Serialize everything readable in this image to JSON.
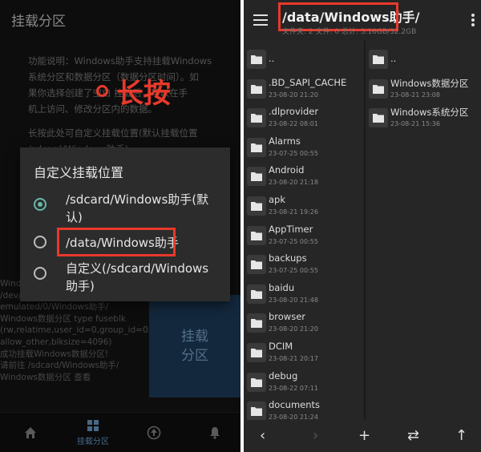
{
  "left": {
    "app_title": "挂载分区",
    "description_lines": [
      "功能说明：Windows助手支持挂载Windows",
      "系统分区和数据分区（数据分区时间）。如",
      "果你选择创建了空白   挂载后，可以在手",
      "机上访问、修改分区内的数据。"
    ],
    "long_press_lines": [
      "长按此处可自定义挂载位置(默认挂载位置",
      "/sdcard/Windows助手)"
    ],
    "long_press_annotation": "长按",
    "log_lines": [
      "Windows",
      "/dev/",
      "emulated/0/Windows助手/",
      "Windows数据分区 type fuseblk",
      "(rw,relatime,user_id=0,group_id=0,",
      "allow_other,blksize=4096)",
      "成功挂载Windows数据分区!",
      "请前往 /sdcard/Windows助手/",
      "Windows数据分区 查看"
    ],
    "mount_button": {
      "line1": "挂载",
      "line2": "分区"
    },
    "dialog": {
      "title": "自定义挂载位置",
      "options": [
        {
          "line1": "/sdcard/Windows助手(默",
          "line2": "认)",
          "selected": true
        },
        {
          "line1": "/data/Windows助手",
          "line2": "",
          "selected": false
        },
        {
          "line1": "自定义(/sdcard/Windows",
          "line2": "助手)",
          "selected": false
        }
      ]
    },
    "bottom_nav": [
      {
        "icon": "home-icon",
        "label": ""
      },
      {
        "icon": "grid-icon",
        "label": "挂载分区",
        "active": true
      },
      {
        "icon": "upload-circle-icon",
        "label": ""
      },
      {
        "icon": "bell-icon",
        "label": ""
      }
    ]
  },
  "right": {
    "path": "/data/Windows助手/",
    "subinfo": "文件夹: 2  文件: 0  总计: 3.16GB/32.2GB",
    "left_pane": [
      {
        "name": "..",
        "date": ""
      },
      {
        "name": ".BD_SAPI_CACHE",
        "date": "23-08-20 21:20"
      },
      {
        "name": ".dlprovider",
        "date": "23-08-22 08:01"
      },
      {
        "name": "Alarms",
        "date": "23-07-25 00:55"
      },
      {
        "name": "Android",
        "date": "23-08-20 21:18"
      },
      {
        "name": "apk",
        "date": "23-08-21 19:26"
      },
      {
        "name": "AppTimer",
        "date": "23-07-25 00:55"
      },
      {
        "name": "backups",
        "date": "23-07-25 00:55"
      },
      {
        "name": "baidu",
        "date": "23-08-20 21:48"
      },
      {
        "name": "browser",
        "date": "23-08-20 21:20"
      },
      {
        "name": "DCIM",
        "date": "23-08-21 20:17"
      },
      {
        "name": "debug",
        "date": "23-08-22 07:11"
      },
      {
        "name": "documents",
        "date": "23-08-20 21:24"
      }
    ],
    "right_pane": [
      {
        "name": "..",
        "date": ""
      },
      {
        "name": "Windows数据分区",
        "date": "23-08-21 23:08"
      },
      {
        "name": "Windows系统分区",
        "date": "23-08-21 15:36"
      }
    ],
    "bottom_icons": [
      "back-arrow-icon",
      "forward-arrow-icon",
      "add-icon",
      "swap-icon",
      "up-arrow-icon"
    ]
  },
  "colors": {
    "accent_red": "#e8392b",
    "radio_teal": "#66b8a8",
    "mount_blue": "#1e3e5e"
  }
}
